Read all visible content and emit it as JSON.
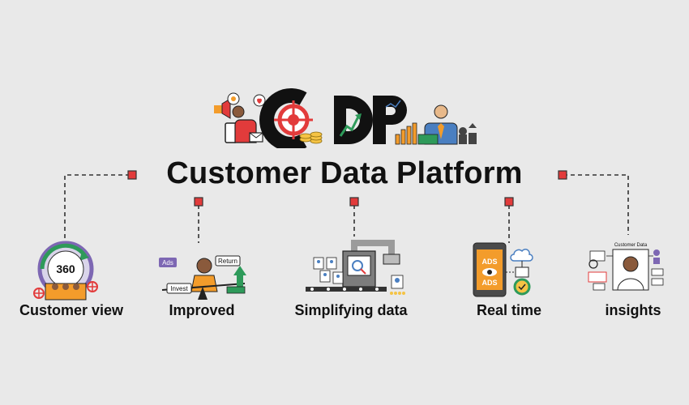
{
  "hero": {
    "acronym": "CDP",
    "title": "Customer Data Platform"
  },
  "colors": {
    "background": "#e9e9e9",
    "connector": "#333333",
    "node": "#e23b3b",
    "accent_orange": "#f39c2b",
    "accent_green": "#2e9a5a",
    "accent_blue": "#4a7fc1"
  },
  "features": [
    {
      "label": "Customer view",
      "icon": "360-customer-view-icon",
      "badge": "360"
    },
    {
      "label": "Improved",
      "icon": "balance-invest-return-icon",
      "tags": [
        "Ads",
        "Return",
        "Invest"
      ]
    },
    {
      "label": "Simplifying data",
      "icon": "data-processing-machine-icon"
    },
    {
      "label": "Real time",
      "icon": "smartphone-ads-realtime-icon",
      "tags": [
        "ADS",
        "ADS"
      ]
    },
    {
      "label": "insights",
      "icon": "customer-data-profile-icon",
      "heading": "Customer Data"
    }
  ]
}
